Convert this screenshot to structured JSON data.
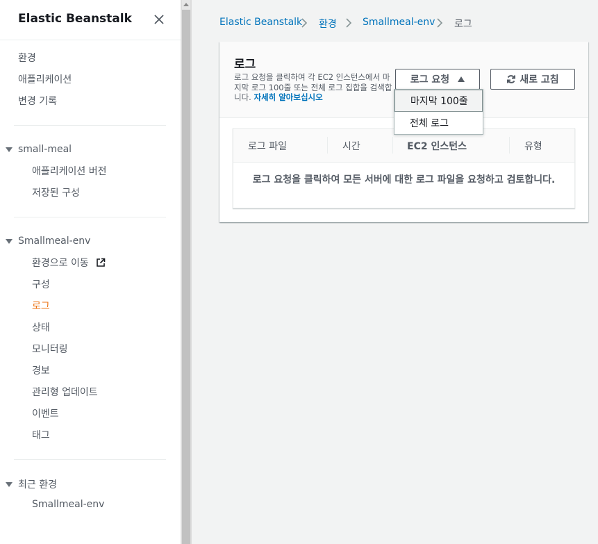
{
  "sidebar": {
    "title": "Elastic Beanstalk",
    "top_items": [
      {
        "label": "환경"
      },
      {
        "label": "애플리케이션"
      },
      {
        "label": "변경 기록"
      }
    ],
    "app_section": {
      "label": "small-meal",
      "items": [
        {
          "label": "애플리케이션 버전"
        },
        {
          "label": "저장된 구성"
        }
      ]
    },
    "env_section": {
      "label": "Smallmeal-env",
      "items": [
        {
          "label": "환경으로 이동"
        },
        {
          "label": "구성"
        },
        {
          "label": "로그",
          "active": true
        },
        {
          "label": "상태"
        },
        {
          "label": "모니터링"
        },
        {
          "label": "경보"
        },
        {
          "label": "관리형 업데이트"
        },
        {
          "label": "이벤트"
        },
        {
          "label": "태그"
        }
      ]
    },
    "recent_section": {
      "label": "최근 환경",
      "items": [
        {
          "label": "Smallmeal-env"
        }
      ]
    }
  },
  "breadcrumb": {
    "items": [
      {
        "label": "Elastic Beanstalk"
      },
      {
        "label": "환경"
      },
      {
        "label": "Smallmeal-env"
      },
      {
        "label": "로그"
      }
    ]
  },
  "panel": {
    "title": "로그",
    "description": "로그 요청을 클릭하여 각 EC2 인스턴스에서 마지막 로그 100줄 또는 전체 로그 집합을 검색합니다.",
    "learn_more": "자세히 알아보십시오",
    "request_button": "로그 요청",
    "refresh_button": "새로 고침",
    "dropdown": [
      {
        "label": "마지막 100줄"
      },
      {
        "label": "전체 로그"
      }
    ]
  },
  "table": {
    "columns": [
      "로그 파일",
      "시간",
      "EC2 인스턴스",
      "유형"
    ],
    "empty_message": "로그 요청을 클릭하여 모든 서버에 대한 로그 파일을 요청하고 검토합니다."
  },
  "colors": {
    "link": "#0073bb",
    "active": "#ec7211",
    "text": "#16191f",
    "muted": "#545b64"
  }
}
